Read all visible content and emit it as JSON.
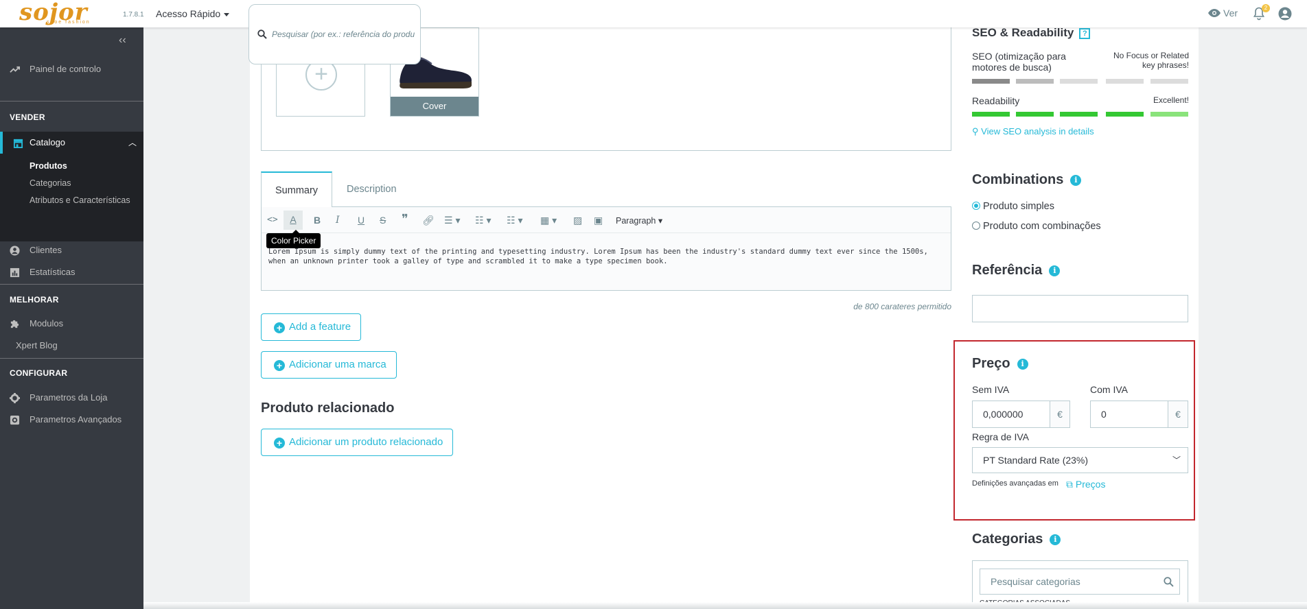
{
  "header": {
    "brand": "sojor",
    "brand_tag": "shoe fashion",
    "version": "1.7.8.1",
    "quick_access": "Acesso Rápido",
    "search_placeholder": "Pesquisar (por ex.: referência do produto",
    "view_label": "Ver",
    "notifications_count": "2"
  },
  "sidebar": {
    "dashboard": "Painel de controlo",
    "sections": [
      {
        "title": "VENDER"
      },
      {
        "title": "MELHORAR"
      },
      {
        "title": "CONFIGURAR"
      }
    ],
    "catalog": "Catalogo",
    "catalog_sub": [
      "Produtos",
      "Categorias",
      "Atributos e Características"
    ],
    "clients": "Clientes",
    "stats": "Estatísticas",
    "modules": "Modulos",
    "xpert_blog": "Xpert Blog",
    "store_params": "Parametros da Loja",
    "advanced_params": "Parametros Avançados"
  },
  "images": {
    "cover_label": "Cover"
  },
  "editor": {
    "tabs": [
      "Summary",
      "Description"
    ],
    "paragraph_label": "Paragraph",
    "tooltip": "Color Picker",
    "content": "Lorem Ipsum is simply dummy text of the printing and typesetting industry. Lorem Ipsum has been the industry's standard dummy text ever since the 1500s, when an unknown printer took a galley of type and scrambled it to make a type specimen book.",
    "char_count": "de 800 carateres permitido"
  },
  "buttons": {
    "add_feature": "Add a feature",
    "add_brand": "Adicionar uma marca",
    "add_related": "Adicionar um produto relacionado"
  },
  "related_title": "Produto relacionado",
  "seo": {
    "title": "SEO & Readability",
    "seo_label": "SEO (otimização para motores de busca)",
    "seo_status": "No Focus or Related key phrases!",
    "readability_label": "Readability",
    "readability_status": "Excellent!",
    "view_link": "View SEO analysis in details",
    "colors": {
      "seo_first": "#8a8a8a",
      "seo_second": "#bcbcbc",
      "seo_rest": "#dcdcdc",
      "read": "#34c833",
      "read_last": "#8ae37b"
    }
  },
  "combinations": {
    "title": "Combinations",
    "options": [
      "Produto simples",
      "Produto com combinações"
    ],
    "selected": 0
  },
  "reference": {
    "title": "Referência",
    "value": ""
  },
  "price": {
    "title": "Preço",
    "without_tax_label": "Sem IVA",
    "without_tax_value": "0,000000",
    "with_tax_label": "Com IVA",
    "with_tax_value": "0",
    "currency": "€",
    "tax_rule_label": "Regra de IVA",
    "tax_rule_value": "PT Standard Rate (23%)",
    "advanced_text": "Definições avançadas em",
    "advanced_link": "Preços"
  },
  "categories": {
    "title": "Categorias",
    "search_placeholder": "Pesquisar categorias",
    "associated_label": "CATEGORIAS ASSOCIADAS"
  }
}
